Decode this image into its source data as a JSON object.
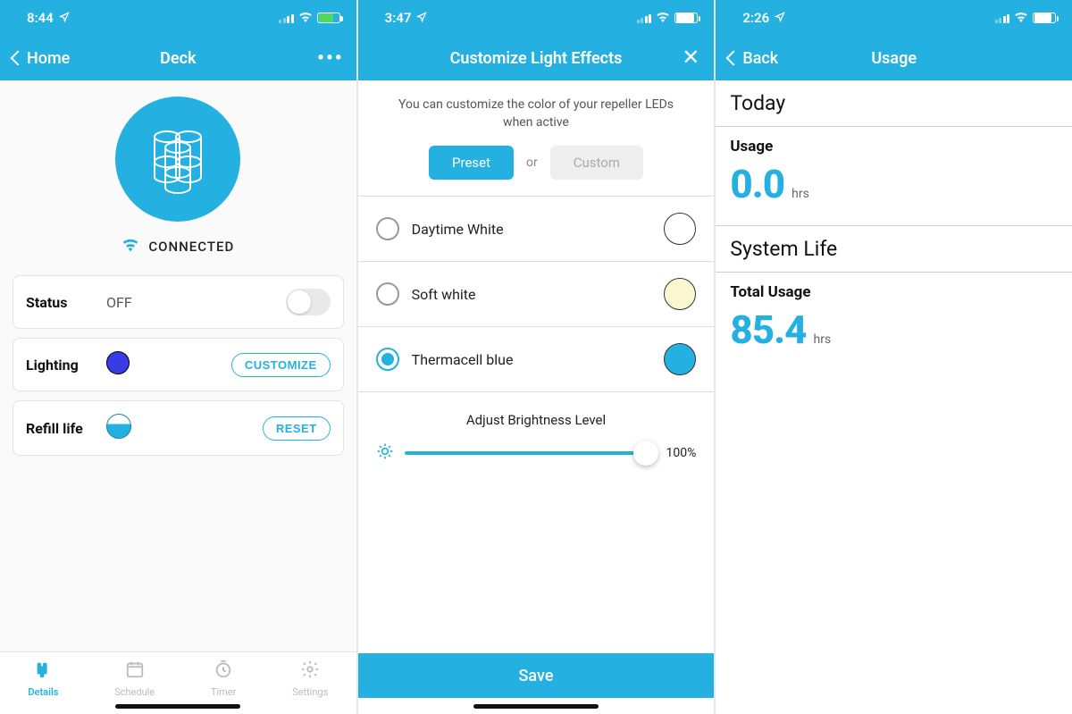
{
  "brand_color": "#24b1e2",
  "screens": {
    "deck": {
      "status_bar": {
        "time": "8:44",
        "battery_style": "green"
      },
      "nav": {
        "back_label": "Home",
        "title": "Deck",
        "more": "•••"
      },
      "connection_label": "CONNECTED",
      "cards": {
        "status": {
          "label": "Status",
          "value": "OFF",
          "toggle_on": false
        },
        "lighting": {
          "label": "Lighting",
          "color": "#3b3be6",
          "button": "CUSTOMIZE"
        },
        "refill": {
          "label": "Refill life",
          "button": "RESET"
        }
      },
      "tabs": [
        {
          "icon": "device",
          "label": "Details",
          "active": true
        },
        {
          "icon": "calendar",
          "label": "Schedule",
          "active": false
        },
        {
          "icon": "timer",
          "label": "Timer",
          "active": false
        },
        {
          "icon": "gear",
          "label": "Settings",
          "active": false
        }
      ]
    },
    "effects": {
      "status_bar": {
        "time": "3:47",
        "battery_style": "white"
      },
      "nav": {
        "title": "Customize Light Effects"
      },
      "helper": "You can customize the color of your repeller LEDs when active",
      "segments": {
        "preset": "Preset",
        "or": "or",
        "custom": "Custom",
        "active": "preset"
      },
      "colors": [
        {
          "name": "Daytime White",
          "swatch": "#ffffff",
          "selected": false
        },
        {
          "name": "Soft white",
          "swatch": "#fbf7cf",
          "selected": false
        },
        {
          "name": "Thermacell blue",
          "swatch": "#24b1e2",
          "selected": true
        }
      ],
      "brightness": {
        "title": "Adjust Brightness Level",
        "value_pct": "100%"
      },
      "save_label": "Save"
    },
    "usage": {
      "status_bar": {
        "time": "2:26",
        "battery_style": "white"
      },
      "nav": {
        "back_label": "Back",
        "title": "Usage"
      },
      "sections": {
        "today_header": "Today",
        "usage_label": "Usage",
        "usage_value": "0.0",
        "usage_unit": "hrs",
        "system_life_header": "System Life",
        "total_label": "Total Usage",
        "total_value": "85.4",
        "total_unit": "hrs"
      }
    }
  }
}
